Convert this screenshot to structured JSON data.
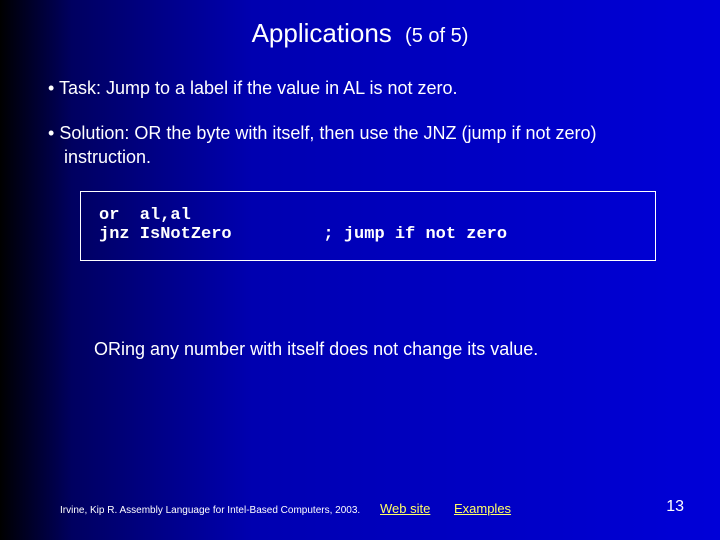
{
  "title": {
    "main": "Applications",
    "sub": "(5 of 5)"
  },
  "bullets": {
    "b1": "Task: Jump to a label if the value in AL is not zero.",
    "b2": "Solution: OR the byte with itself, then use the JNZ (jump if not zero) instruction."
  },
  "code": "or  al,al\njnz IsNotZero         ; jump if not zero",
  "note": "ORing any number with itself does not change its value.",
  "footer": {
    "cite": "Irvine, Kip R. Assembly Language for Intel-Based Computers, 2003.",
    "link1": "Web site",
    "link2": "Examples",
    "page": "13"
  }
}
